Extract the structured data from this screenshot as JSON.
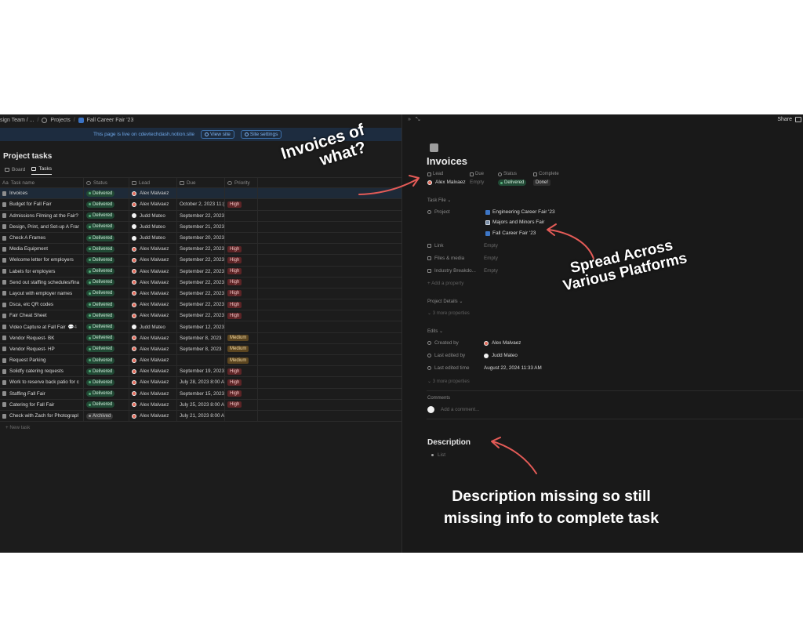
{
  "breadcrumb": [
    "sign Team / ...",
    "Projects",
    "Fall Career Fair '23"
  ],
  "banner": {
    "message": "This page is live on cdevtechdash.notion.site",
    "view_site": "View site",
    "site_settings": "Site settings"
  },
  "database": {
    "title": "Project tasks",
    "views": [
      {
        "label": "Board",
        "icon": "board-icon"
      },
      {
        "label": "Tasks",
        "icon": "table-icon"
      }
    ],
    "columns": {
      "name": "Task name",
      "name_prefix": "Aa",
      "status": "Status",
      "lead": "Lead",
      "due": "Due",
      "priority": "Priority"
    },
    "rows": [
      {
        "name": "Invoices",
        "status": "Delivered",
        "lead": "Alex Malvaez",
        "lead_avatar": "red",
        "due": "",
        "priority": "",
        "selected": true
      },
      {
        "name": "Budget for Fall Fair",
        "status": "Delivered",
        "lead": "Alex Malvaez",
        "lead_avatar": "red",
        "due": "October 2, 2023 11:(",
        "priority": "High"
      },
      {
        "name": "Admissions Filming at the Fair?",
        "status": "Delivered",
        "lead": "Judd Mateo",
        "lead_avatar": "white",
        "due": "September 22, 2023",
        "priority": ""
      },
      {
        "name": "Design, Print, and Set-up A Frar",
        "status": "Delivered",
        "lead": "Judd Mateo",
        "lead_avatar": "white",
        "due": "September 21, 2023",
        "priority": ""
      },
      {
        "name": "Check A Frames",
        "status": "Delivered",
        "lead": "Judd Mateo",
        "lead_avatar": "white",
        "due": "September 20, 2023",
        "priority": ""
      },
      {
        "name": "Media Equipment",
        "status": "Delivered",
        "lead": "Alex Malvaez",
        "lead_avatar": "red",
        "due": "September 22, 2023",
        "priority": "High"
      },
      {
        "name": "Welcome letter for employers",
        "status": "Delivered",
        "lead": "Alex Malvaez",
        "lead_avatar": "red",
        "due": "September 22, 2023",
        "priority": "High"
      },
      {
        "name": "Labels for employers",
        "status": "Delivered",
        "lead": "Alex Malvaez",
        "lead_avatar": "red",
        "due": "September 22, 2023",
        "priority": "High"
      },
      {
        "name": "Send out staffing schedules/fina",
        "status": "Delivered",
        "lead": "Alex Malvaez",
        "lead_avatar": "red",
        "due": "September 22, 2023",
        "priority": "High"
      },
      {
        "name": "Layout with employer names",
        "status": "Delivered",
        "lead": "Alex Malvaez",
        "lead_avatar": "red",
        "due": "September 22, 2023",
        "priority": "High"
      },
      {
        "name": "Dsca, etc QR codes",
        "status": "Delivered",
        "lead": "Alex Malvaez",
        "lead_avatar": "red",
        "due": "September 22, 2023",
        "priority": "High"
      },
      {
        "name": "Fair Cheat Sheet",
        "status": "Delivered",
        "lead": "Alex Malvaez",
        "lead_avatar": "red",
        "due": "September 22, 2023",
        "priority": "High"
      },
      {
        "name": "Video Capture at Fall Fair",
        "comments": "4",
        "status": "Delivered",
        "lead": "Judd Mateo",
        "lead_avatar": "white",
        "due": "September 12, 2023",
        "priority": ""
      },
      {
        "name": "Vendor Request- BK",
        "status": "Delivered",
        "lead": "Alex Malvaez",
        "lead_avatar": "red",
        "due": "September 8, 2023",
        "priority": "Medium"
      },
      {
        "name": "Vendor Request- HP",
        "status": "Delivered",
        "lead": "Alex Malvaez",
        "lead_avatar": "red",
        "due": "September 8, 2023",
        "priority": "Medium"
      },
      {
        "name": "Request Parking",
        "status": "Delivered",
        "lead": "Alex Malvaez",
        "lead_avatar": "red",
        "due": "",
        "priority": "Medium"
      },
      {
        "name": "Solidfy catering requests",
        "status": "Delivered",
        "lead": "Alex Malvaez",
        "lead_avatar": "red",
        "due": "September 19, 2023",
        "priority": "High"
      },
      {
        "name": "Work to reserve back patio for c",
        "status": "Delivered",
        "lead": "Alex Malvaez",
        "lead_avatar": "red",
        "due": "July 28, 2023 8:00 A",
        "priority": "High"
      },
      {
        "name": "Staffing Fall Fair",
        "status": "Delivered",
        "lead": "Alex Malvaez",
        "lead_avatar": "red",
        "due": "September 15, 2023",
        "priority": "High"
      },
      {
        "name": "Catering for Fall Fair",
        "status": "Delivered",
        "lead": "Alex Malvaez",
        "lead_avatar": "red",
        "due": "July 25, 2023 8:00 A",
        "priority": "High"
      },
      {
        "name": "Check with Zach for Photograpl",
        "status": "Archived",
        "lead": "Alex Malvaez",
        "lead_avatar": "red",
        "due": "July 21, 2023 8:00 A",
        "priority": ""
      }
    ],
    "new_task": "+ New task"
  },
  "detail": {
    "topbar_icons": "» ⤡",
    "share": "Share",
    "title": "Invoices",
    "props": {
      "lead_label": "Lead",
      "due_label": "Due",
      "status_label": "Status",
      "complete_label": "Complete",
      "lead_value": "Alex Malvaez",
      "due_value": "Empty",
      "status_value": "Delivered",
      "complete_value": "Done!"
    },
    "task_file_label": "Task File ⌄",
    "project_label": "Project",
    "projects": [
      "Engineering Career Fair '23",
      "Majors and Minors Fair",
      "Fall Career Fair '23"
    ],
    "extra_props": [
      {
        "label": "Link",
        "value": "Empty"
      },
      {
        "label": "Files & media",
        "value": "Empty"
      },
      {
        "label": "Industry Breakdo...",
        "value": "Empty"
      }
    ],
    "add_property": "+ Add a property",
    "project_details": "Project Details ⌄",
    "more_props_1": "⌄ 3 more properties",
    "edits_label": "Edits ⌄",
    "created_by_label": "Created by",
    "created_by_value": "Alex Malvaez",
    "last_edited_by_label": "Last edited by",
    "last_edited_by_value": "Judd Mateo",
    "last_edited_time_label": "Last edited time",
    "last_edited_time_value": "August 22, 2024 11:33 AM",
    "more_props_2": "⌄ 3 more properties",
    "comments_label": "Comments",
    "add_comment": "Add a comment...",
    "description_title": "Description",
    "description_bullet": "List"
  },
  "annotations": {
    "a1_line1": "Invoices of",
    "a1_line2": "what?",
    "a2_line1": "Spread Across",
    "a2_line2": "Various Platforms",
    "a3_line1": "Description missing so still",
    "a3_line2": "missing info to complete task",
    "arrow_color": "#e45b57"
  }
}
